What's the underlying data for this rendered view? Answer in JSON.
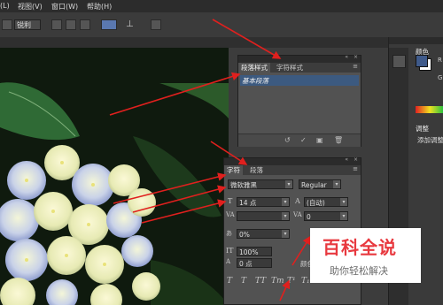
{
  "menu": {
    "items": [
      "(L)",
      "视图(V)",
      "窗口(W)",
      "帮助(H)"
    ]
  },
  "options_bar": {
    "style_value": "锐利"
  },
  "paragraph_styles_panel": {
    "tabs": [
      "段落样式",
      "字符样式"
    ],
    "active_tab": "段落样式",
    "items": [
      "基本段落"
    ]
  },
  "character_panel": {
    "tabs": [
      "字符",
      "段落"
    ],
    "active_tab": "字符",
    "font_family": "微软雅黑",
    "font_style": "Regular",
    "font_size": "14 点",
    "leading": "(自动)",
    "tracking": "0",
    "kerning_scale": "0%",
    "vertical_scale": "100%",
    "baseline_shift": "0 点",
    "color_label": "颜色："
  },
  "right_dock": {
    "color_tab": "颜色",
    "adjust_tab": "调整",
    "adjust_hint": "添加调整",
    "channel_labels": [
      "R",
      "G"
    ]
  },
  "watermark": {
    "title": "百科全说",
    "subtitle": "助你轻松解决"
  },
  "colors": {
    "arrow": "#e0201e",
    "panel": "#525252",
    "field": "#3a3a3a"
  }
}
